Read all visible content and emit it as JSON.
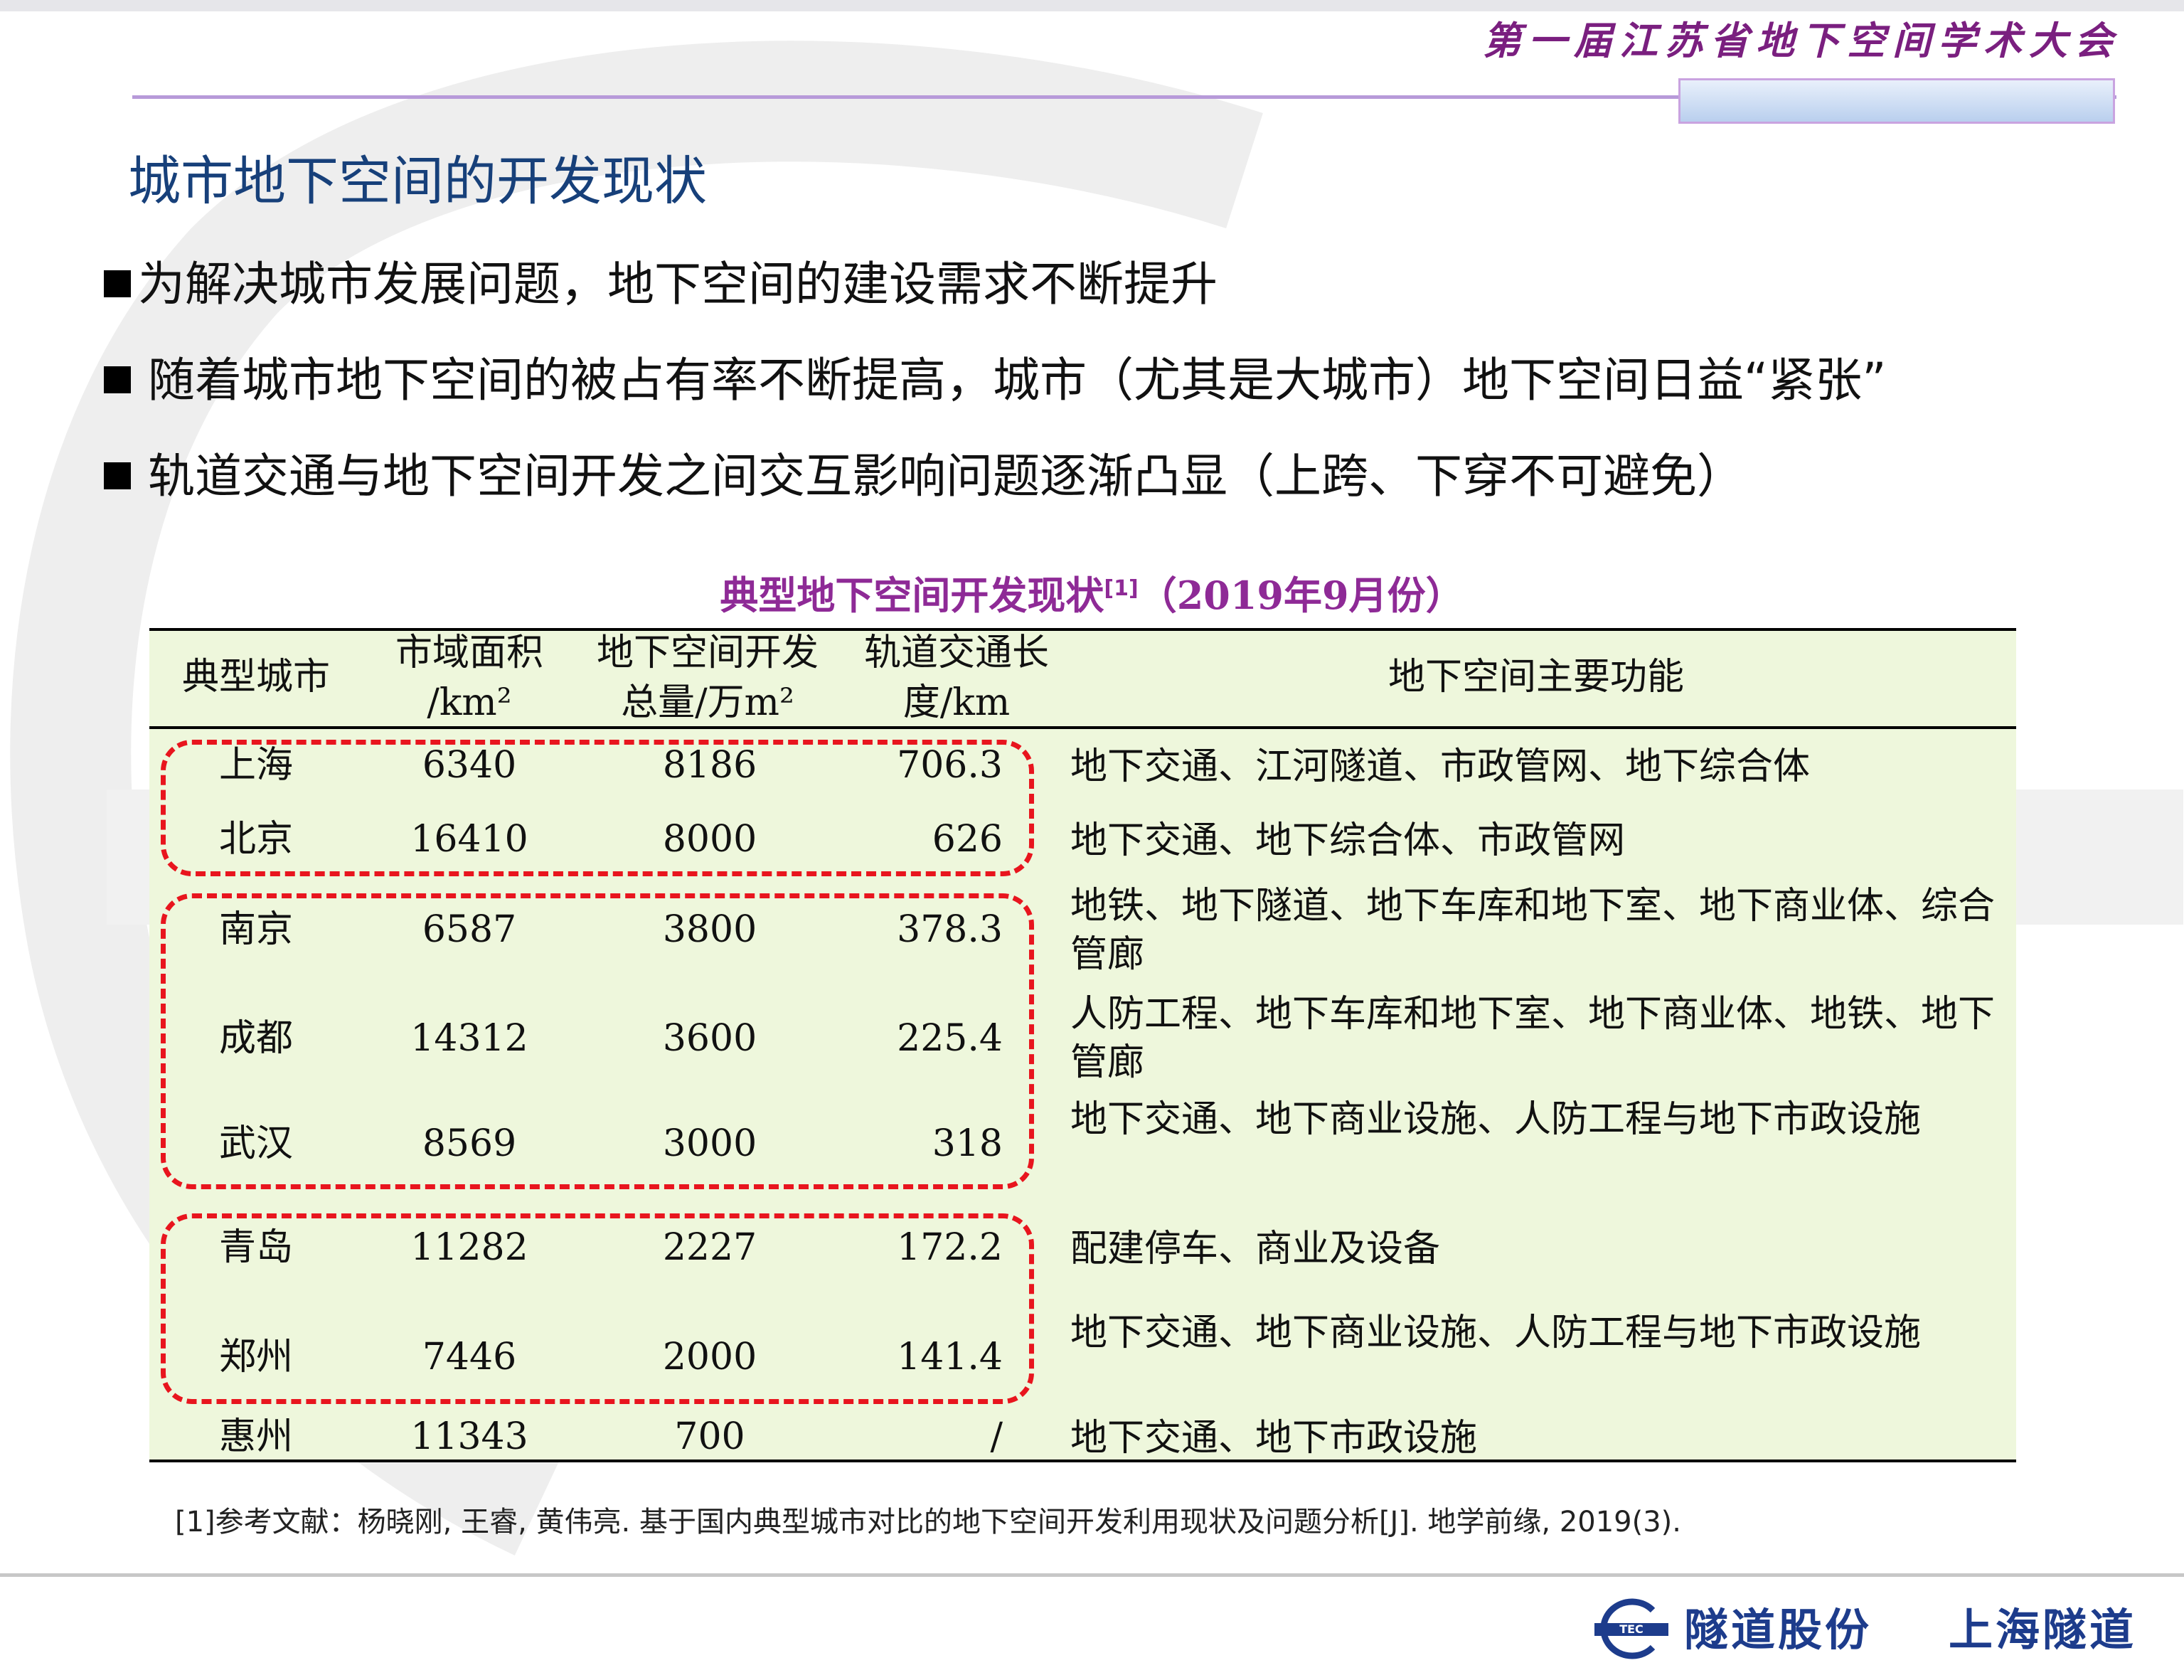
{
  "header": {
    "conference_title": "第一届江苏省地下空间学术大会"
  },
  "page_title": "城市地下空间的开发现状",
  "bullets": [
    "为解决城市发展问题，地下空间的建设需求不断提升",
    "随着城市地下空间的被占有率不断提高，城市（尤其是大城市）地下空间日益“紧张”",
    "轨道交通与地下空间开发之间交互影响问题逐渐凸显（上跨、下穿不可避免）"
  ],
  "table": {
    "caption_main": "典型地下空间开发现状",
    "caption_ref": "[1]",
    "caption_year": "（2019年9月份）",
    "headers": {
      "city": "典型城市",
      "area_line1": "市域面积",
      "area_line2": "/km²",
      "total_line1": "地下空间开发",
      "total_line2": "总量/万m²",
      "rail_line1": "轨道交通长",
      "rail_line2": "度/km",
      "function": "地下空间主要功能"
    },
    "rows": [
      {
        "city": "上海",
        "area": "6340",
        "total": "8186",
        "rail": "706.3",
        "function": "地下交通、江河隧道、市政管网、地下综合体"
      },
      {
        "city": "北京",
        "area": "16410",
        "total": "8000",
        "rail": "626",
        "function": "地下交通、地下综合体、市政管网"
      },
      {
        "city": "南京",
        "area": "6587",
        "total": "3800",
        "rail": "378.3",
        "function": "地铁、地下隧道、地下车库和地下室、地下商业体、综合管廊"
      },
      {
        "city": "成都",
        "area": "14312",
        "total": "3600",
        "rail": "225.4",
        "function": "人防工程、地下车库和地下室、地下商业体、地铁、地下管廊"
      },
      {
        "city": "武汉",
        "area": "8569",
        "total": "3000",
        "rail": "318",
        "function": "地下交通、地下商业设施、人防工程与地下市政设施"
      },
      {
        "city": "青岛",
        "area": "11282",
        "total": "2227",
        "rail": "172.2",
        "function": "配建停车、商业及设备"
      },
      {
        "city": "郑州",
        "area": "7446",
        "total": "2000",
        "rail": "141.4",
        "function": "地下交通、地下商业设施、人防工程与地下市政设施"
      },
      {
        "city": "惠州",
        "area": "11343",
        "total": "700",
        "rail": "/",
        "function": "地下交通、地下市政设施"
      }
    ]
  },
  "footnote": "[1]参考文献：杨晓刚, 王睿, 黄伟亮. 基于国内典型城市对比的地下空间开发利用现状及问题分析[J]. 地学前缘, 2019(3).",
  "footer": {
    "logo_abbr": "TEC",
    "company_1": "隧道股份",
    "company_2": "上海隧道"
  },
  "colors": {
    "conference_title": "#7a1f7f",
    "page_title": "#17407a",
    "caption": "#8e2a96",
    "table_bg": "#eef7dc",
    "highlight_dash": "#e8151e",
    "logo": "#1d3c8c"
  }
}
